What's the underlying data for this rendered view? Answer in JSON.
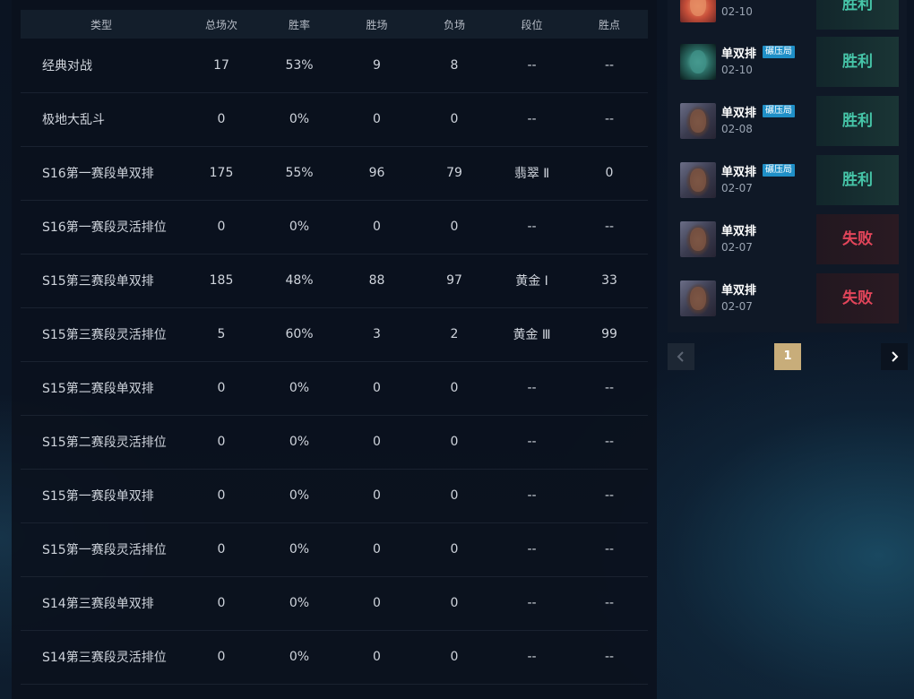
{
  "stats": {
    "headers": [
      "类型",
      "总场次",
      "胜率",
      "胜场",
      "负场",
      "段位",
      "胜点"
    ],
    "rows": [
      [
        "经典对战",
        "17",
        "53%",
        "9",
        "8",
        "--",
        "--"
      ],
      [
        "极地大乱斗",
        "0",
        "0%",
        "0",
        "0",
        "--",
        "--"
      ],
      [
        "S16第一赛段单双排",
        "175",
        "55%",
        "96",
        "79",
        "翡翠 Ⅱ",
        "0"
      ],
      [
        "S16第一赛段灵活排位",
        "0",
        "0%",
        "0",
        "0",
        "--",
        "--"
      ],
      [
        "S15第三赛段单双排",
        "185",
        "48%",
        "88",
        "97",
        "黄金 Ⅰ",
        "33"
      ],
      [
        "S15第三赛段灵活排位",
        "5",
        "60%",
        "3",
        "2",
        "黄金 Ⅲ",
        "99"
      ],
      [
        "S15第二赛段单双排",
        "0",
        "0%",
        "0",
        "0",
        "--",
        "--"
      ],
      [
        "S15第二赛段灵活排位",
        "0",
        "0%",
        "0",
        "0",
        "--",
        "--"
      ],
      [
        "S15第一赛段单双排",
        "0",
        "0%",
        "0",
        "0",
        "--",
        "--"
      ],
      [
        "S15第一赛段灵活排位",
        "0",
        "0%",
        "0",
        "0",
        "--",
        "--"
      ],
      [
        "S14第三赛段单双排",
        "0",
        "0%",
        "0",
        "0",
        "--",
        "--"
      ],
      [
        "S14第三赛段灵活排位",
        "0",
        "0%",
        "0",
        "0",
        "--",
        "--"
      ]
    ]
  },
  "matches": [
    {
      "queue": "",
      "date": "02-10",
      "badge": "",
      "result": "胜利",
      "outcome": "win",
      "avatar": "red"
    },
    {
      "queue": "单双排",
      "date": "02-10",
      "badge": "碾压局",
      "result": "胜利",
      "outcome": "win",
      "avatar": "green"
    },
    {
      "queue": "单双排",
      "date": "02-08",
      "badge": "碾压局",
      "result": "胜利",
      "outcome": "win",
      "avatar": "dark"
    },
    {
      "queue": "单双排",
      "date": "02-07",
      "badge": "碾压局",
      "result": "胜利",
      "outcome": "win",
      "avatar": "dark"
    },
    {
      "queue": "单双排",
      "date": "02-07",
      "badge": "",
      "result": "失败",
      "outcome": "lose",
      "avatar": "dark"
    },
    {
      "queue": "单双排",
      "date": "02-07",
      "badge": "",
      "result": "失败",
      "outcome": "lose",
      "avatar": "dark"
    }
  ],
  "pagination": {
    "current_page": "1",
    "prev_icon": "chevron-left-icon",
    "next_icon": "chevron-right-icon"
  },
  "colors": {
    "win": "#46c5a8",
    "lose": "#e2455a",
    "badge": "#1f8fc7",
    "active_page": "#c8ad7a"
  }
}
